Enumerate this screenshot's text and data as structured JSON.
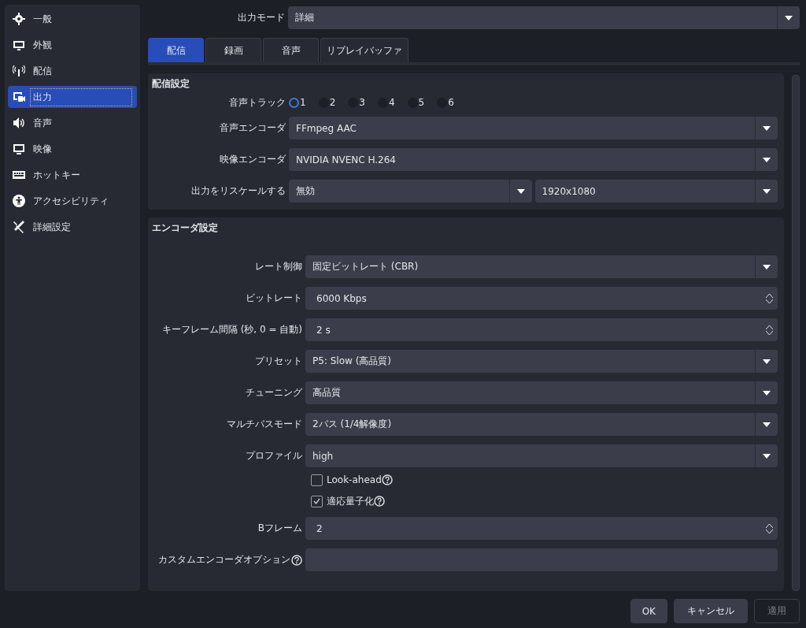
{
  "sidebar": {
    "items": [
      {
        "label": "一般",
        "selected": false
      },
      {
        "label": "外観",
        "selected": false
      },
      {
        "label": "配信",
        "selected": false
      },
      {
        "label": "出力",
        "selected": true
      },
      {
        "label": "音声",
        "selected": false
      },
      {
        "label": "映像",
        "selected": false
      },
      {
        "label": "ホットキー",
        "selected": false
      },
      {
        "label": "アクセシビリティ",
        "selected": false
      },
      {
        "label": "詳細設定",
        "selected": false
      }
    ]
  },
  "output_mode": {
    "label": "出力モード",
    "value": "詳細"
  },
  "tabs": [
    {
      "label": "配信",
      "selected": true
    },
    {
      "label": "録画",
      "selected": false
    },
    {
      "label": "音声",
      "selected": false
    },
    {
      "label": "リプレイバッファ",
      "selected": false
    }
  ],
  "stream_settings": {
    "title": "配信設定",
    "audio_track": {
      "label": "音声トラック",
      "options": [
        {
          "label": "1",
          "selected": true
        },
        {
          "label": "2",
          "selected": false
        },
        {
          "label": "3",
          "selected": false
        },
        {
          "label": "4",
          "selected": false
        },
        {
          "label": "5",
          "selected": false
        },
        {
          "label": "6",
          "selected": false
        }
      ]
    },
    "rows": [
      {
        "label": "音声エンコーダ",
        "values": [
          "FFmpeg AAC"
        ]
      },
      {
        "label": "映像エンコーダ",
        "values": [
          "NVIDIA NVENC H.264"
        ]
      },
      {
        "label": "出力をリスケールする",
        "values": [
          "無効",
          "1920x1080"
        ]
      }
    ]
  },
  "encoder_settings": {
    "title": "エンコーダ設定",
    "rows": [
      {
        "kind": "select",
        "label": "レート制御",
        "value": "固定ビットレート (CBR)"
      },
      {
        "kind": "spin",
        "label": "ビットレート",
        "value": "6000 Kbps"
      },
      {
        "kind": "spin",
        "label": "キーフレーム間隔 (秒, 0 = 自動)",
        "value": "2 s"
      },
      {
        "kind": "select",
        "label": "プリセット",
        "value": "P5: Slow (高品質)"
      },
      {
        "kind": "select",
        "label": "チューニング",
        "value": "高品質"
      },
      {
        "kind": "select",
        "label": "マルチパスモード",
        "value": "2パス (1/4解像度)"
      },
      {
        "kind": "select",
        "label": "プロファイル",
        "value": "high"
      },
      {
        "kind": "checkbox",
        "label": "Look-ahead",
        "checked": false,
        "help": true
      },
      {
        "kind": "checkbox",
        "label": "適応量子化",
        "checked": true,
        "help": true
      },
      {
        "kind": "spin",
        "label": "Bフレーム",
        "value": "2"
      },
      {
        "kind": "text",
        "label": "カスタムエンコーダオプション",
        "help": true
      }
    ]
  },
  "buttons": [
    {
      "label": "OK",
      "disabled": false
    },
    {
      "label": "キャンセル",
      "disabled": false
    },
    {
      "label": "適用",
      "disabled": true
    }
  ]
}
